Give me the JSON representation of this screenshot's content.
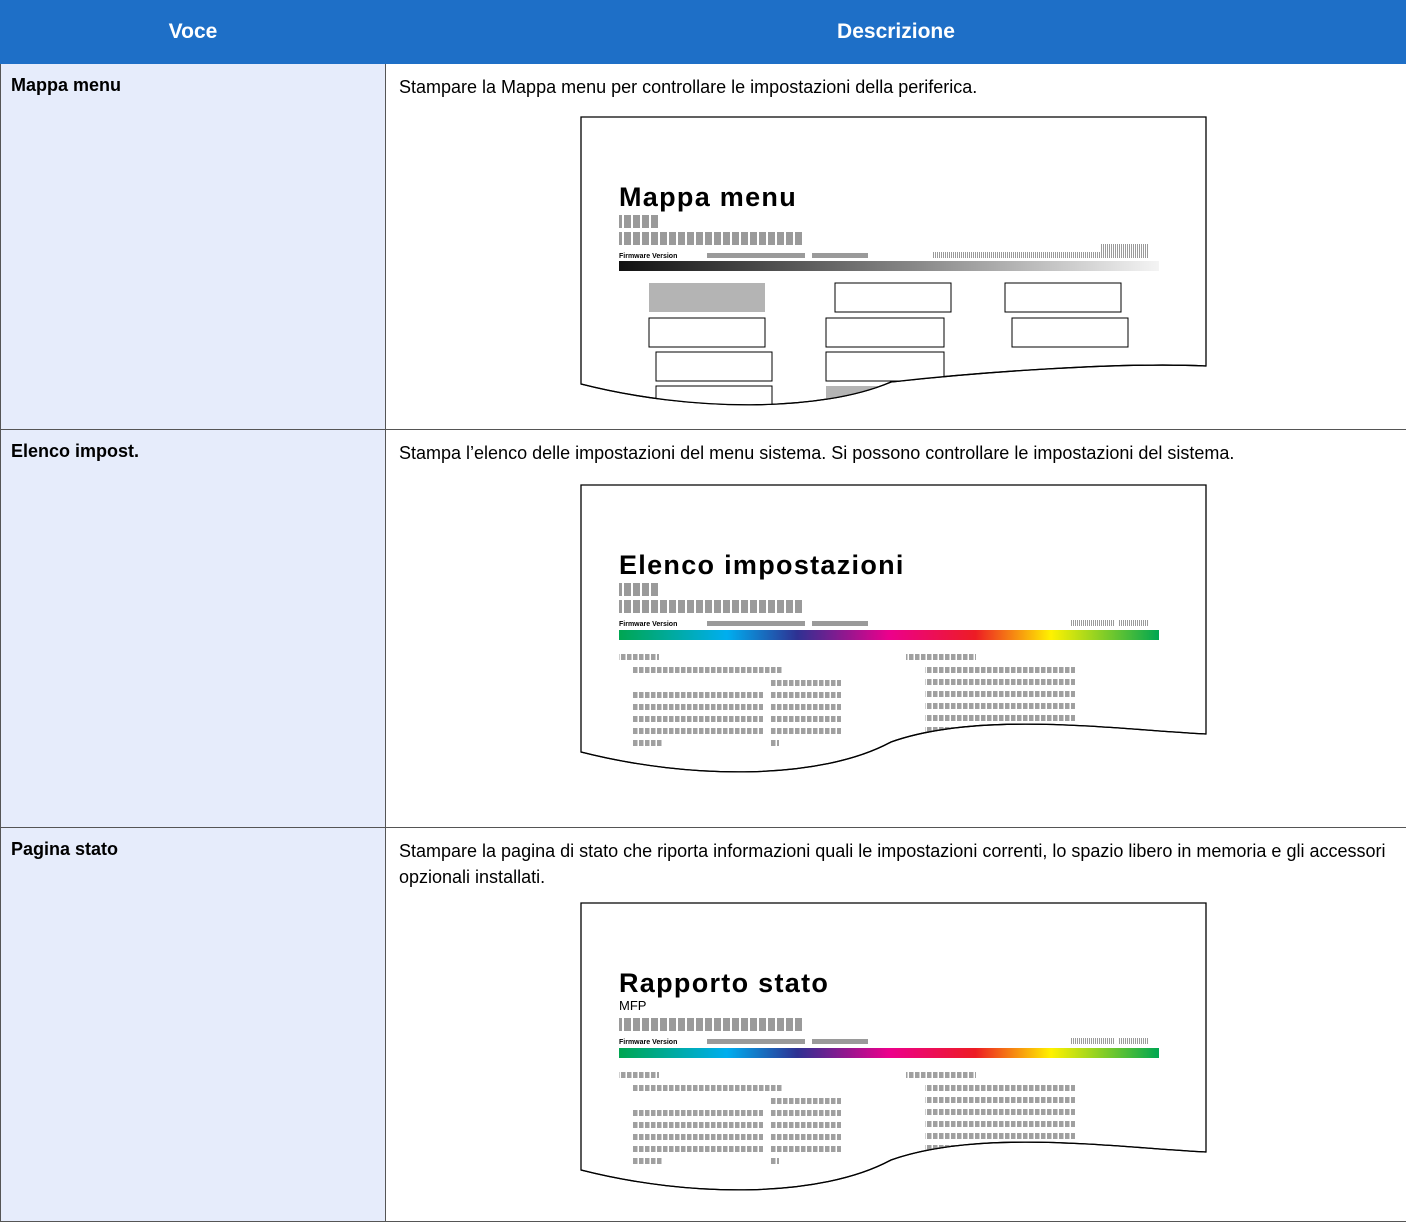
{
  "table": {
    "headers": {
      "item": "Voce",
      "description": "Descrizione"
    },
    "rows": [
      {
        "item": "Mappa menu",
        "description": "Stampare la Mappa menu per controllare le impostazioni della periferica.",
        "figure": {
          "title": "Mappa menu",
          "firmware_label": "Firmware Version"
        }
      },
      {
        "item": "Elenco impost.",
        "description": "Stampa l’elenco delle impostazioni del menu sistema. Si possono controllare le impostazioni del sistema.",
        "figure": {
          "title": "Elenco impostazioni",
          "firmware_label": "Firmware Version"
        }
      },
      {
        "item": "Pagina stato",
        "description": "Stampare la pagina di stato che riporta informazioni quali le impostazioni correnti, lo spazio libero in memoria e gli accessori opzionali installati.",
        "figure": {
          "title": "Rapporto stato",
          "subtitle": "MFP",
          "firmware_label": "Firmware Version"
        }
      }
    ]
  }
}
